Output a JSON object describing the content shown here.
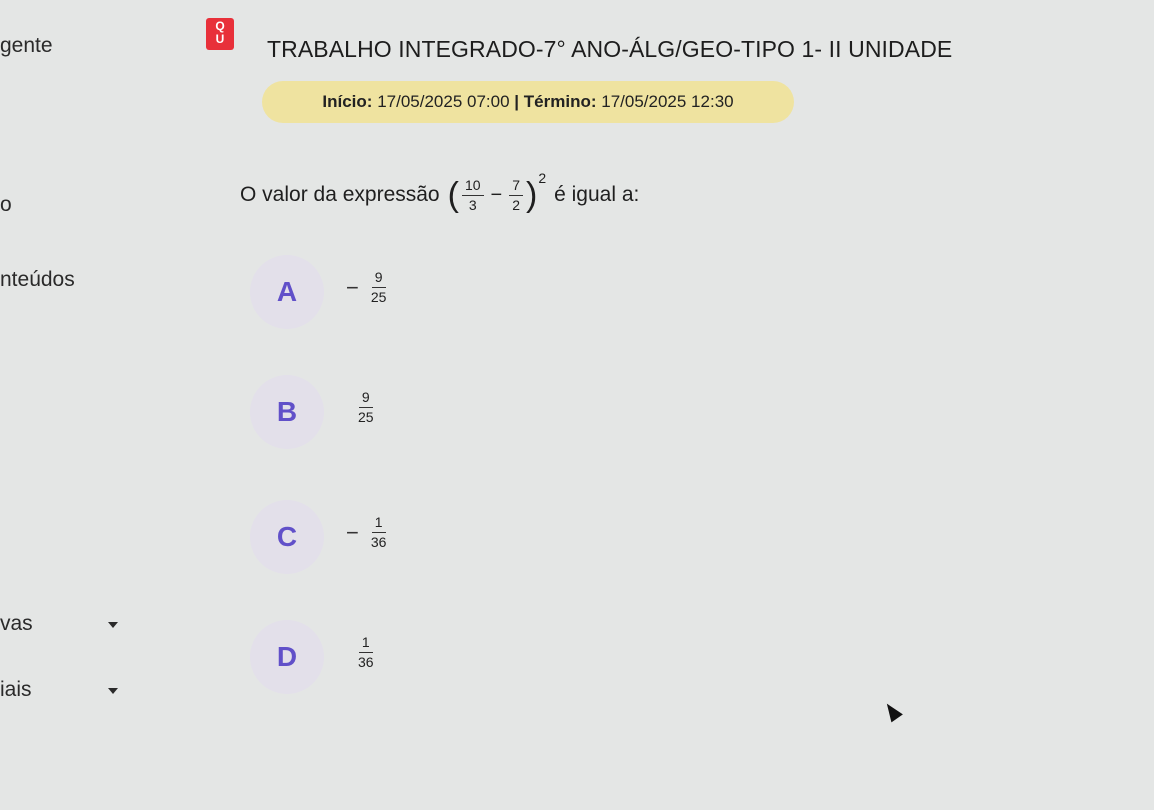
{
  "sidebar": {
    "items": [
      {
        "label": "gente"
      },
      {
        "label": "o"
      },
      {
        "label": "nteúdos"
      },
      {
        "label": "vas"
      },
      {
        "label": "iais"
      }
    ]
  },
  "quiz": {
    "icon": "quiz-icon",
    "icon_glyph_top": "Q",
    "icon_glyph_bottom": "U",
    "title": "TRABALHO INTEGRADO-7° ANO-ÁLG/GEO-TIPO 1- II UNIDADE",
    "start_label": "Início:",
    "start_value": "17/05/2025 07:00",
    "separator": "|",
    "end_label": "Término:",
    "end_value": "17/05/2025 12:30",
    "accent_color": "#6150c9",
    "schedule_color": "#efe3a0"
  },
  "question": {
    "prefix": "O valor da expressão",
    "open_paren": "(",
    "frac1_num": "10",
    "frac1_den": "3",
    "minus": "−",
    "frac2_num": "7",
    "frac2_den": "2",
    "close_paren": ")",
    "exponent": "2",
    "suffix": "é igual a:"
  },
  "options": [
    {
      "letter": "A",
      "sign": "−",
      "num": "9",
      "den": "25"
    },
    {
      "letter": "B",
      "sign": "",
      "num": "9",
      "den": "25"
    },
    {
      "letter": "C",
      "sign": "−",
      "num": "1",
      "den": "36"
    },
    {
      "letter": "D",
      "sign": "",
      "num": "1",
      "den": "36"
    }
  ]
}
